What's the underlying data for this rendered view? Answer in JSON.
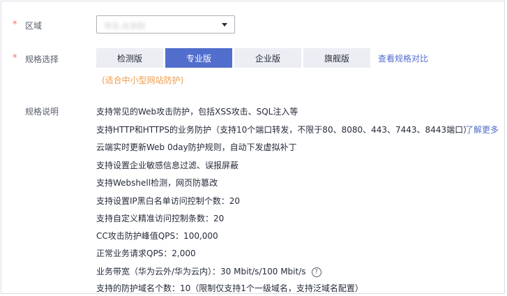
{
  "region": {
    "label": "区域",
    "required_mark": "*",
    "selected_value": "华北-北京四"
  },
  "spec_select": {
    "label": "规格选择",
    "required_mark": "*",
    "tabs": [
      {
        "label": "检测版",
        "active": false
      },
      {
        "label": "专业版",
        "active": true
      },
      {
        "label": "企业版",
        "active": false
      },
      {
        "label": "旗舰版",
        "active": false
      }
    ],
    "compare_link": "查看规格对比",
    "hint": "(适合中小型网站防护)"
  },
  "spec_desc": {
    "label": "规格说明",
    "items": [
      "支持常见的Web攻击防护，包括XSS攻击、SQL注入等",
      "支持HTTP和HTTPS的业务防护（支持10个端口转发，不限于80、8080、443、7443、8443端口）",
      "云端实时更新Web 0day防护规则，自动下发虚拟补丁",
      "支持设置企业敏感信息过滤、误报屏蔽",
      "支持Webshell检测，网页防篡改",
      "支持设置IP黑白名单访问控制个数：20",
      "支持自定义精准访问控制条数：20",
      "CC攻击防护峰值QPS：100,000",
      "正常业务请求QPS：2,000",
      "业务带宽（华为云外/华为云内）：30 Mbit/s/100 Mbit/s",
      "支持的防护域名个数：10（限制仅支持1个一级域名，支持泛域名配置）"
    ],
    "learn_more": "了解更多",
    "help_glyph": "?"
  }
}
